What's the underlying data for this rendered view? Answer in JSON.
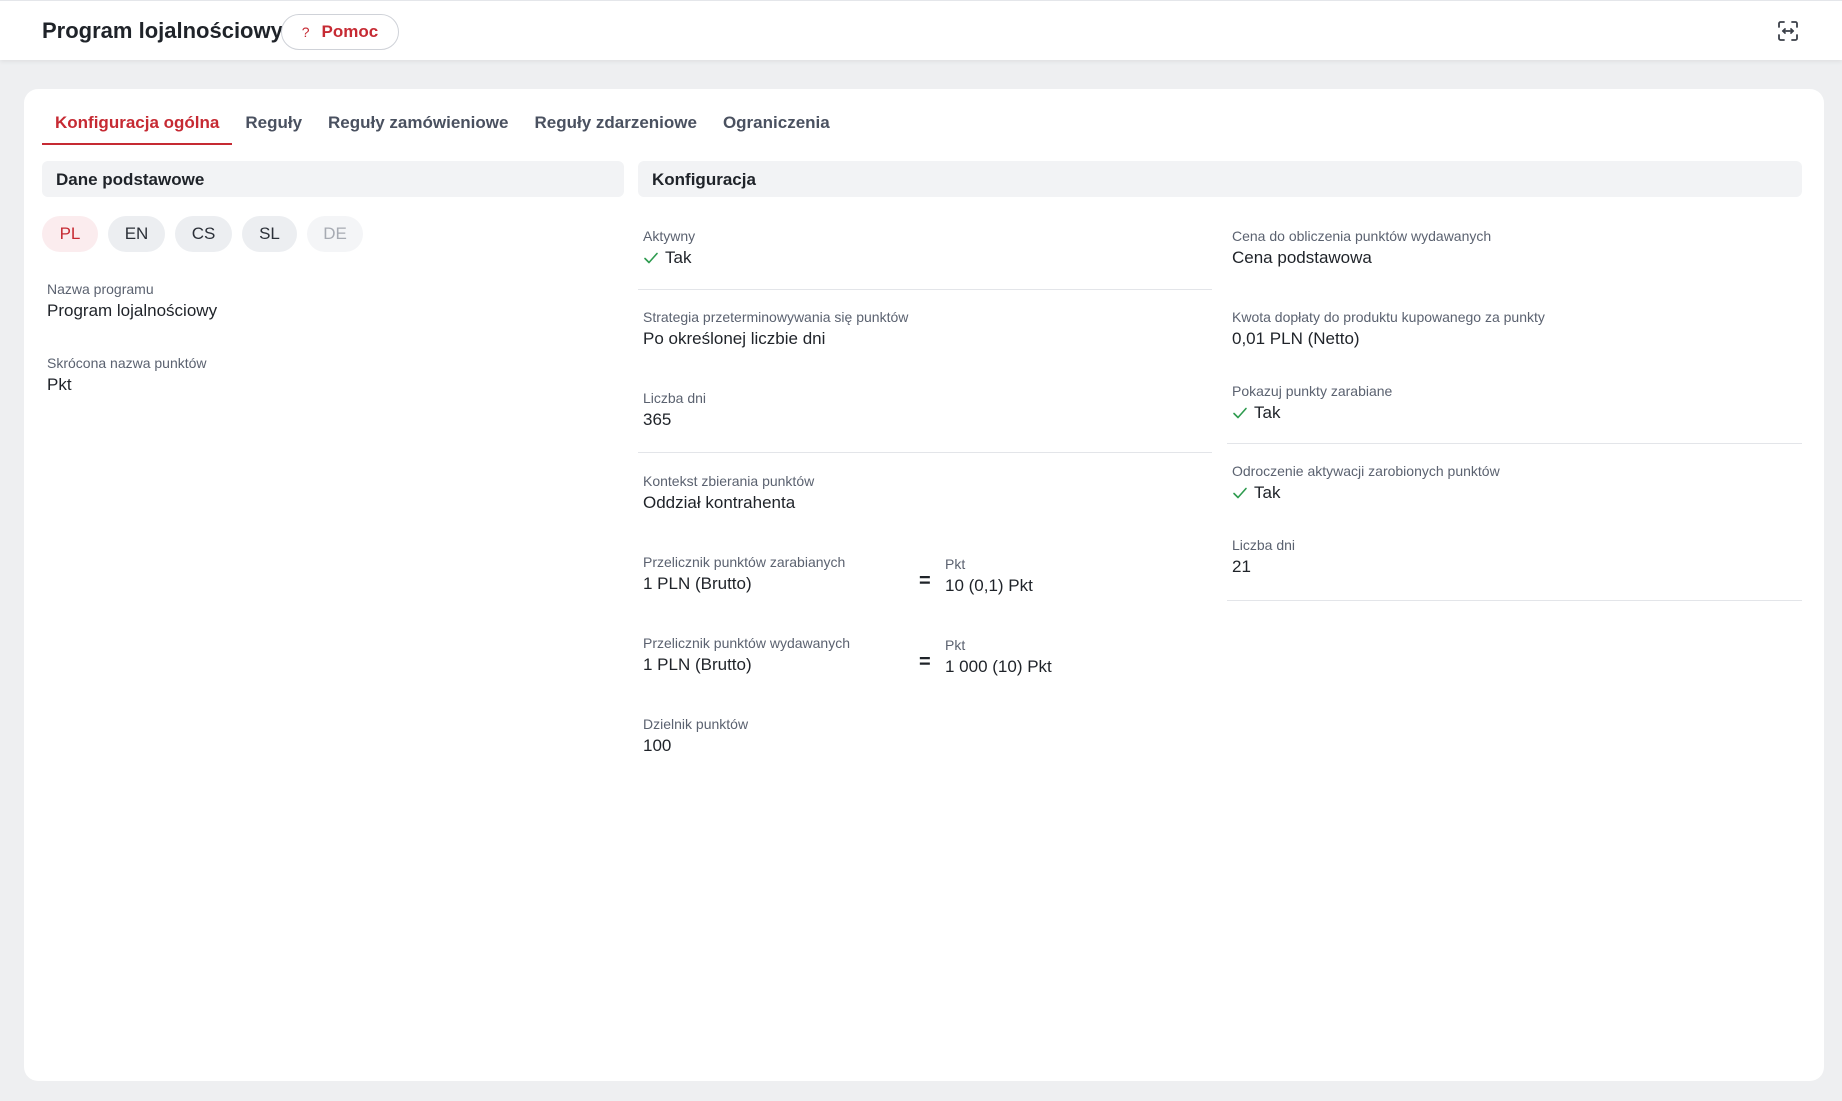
{
  "header": {
    "title": "Program lojalnościowy",
    "help_icon": "?",
    "help_label": "Pomoc"
  },
  "tabs": [
    {
      "label": "Konfiguracja ogólna",
      "active": true
    },
    {
      "label": "Reguły"
    },
    {
      "label": "Reguły zamówieniowe"
    },
    {
      "label": "Reguły zdarzeniowe"
    },
    {
      "label": "Ograniczenia"
    }
  ],
  "basic": {
    "header": "Dane podstawowe",
    "languages": [
      "PL",
      "EN",
      "CS",
      "SL",
      "DE"
    ],
    "active_language": "PL",
    "disabled_language": "DE",
    "program_name_label": "Nazwa programu",
    "program_name_value": "Program lojalnościowy",
    "short_name_label": "Skrócona nazwa punktów",
    "short_name_value": "Pkt"
  },
  "config": {
    "header": "Konfiguracja",
    "active_label": "Aktywny",
    "active_value": "Tak",
    "expiry_strategy_label": "Strategia przeterminowywania się punktów",
    "expiry_strategy_value": "Po określonej liczbie dni",
    "days_label": "Liczba dni",
    "days_value": "365",
    "context_label": "Kontekst zbierania punktów",
    "context_value": "Oddział kontrahenta",
    "earn_label": "Przelicznik punktów zarabianych",
    "earn_value": "1 PLN (Brutto)",
    "earn_eq": "=",
    "earn_unit_label": "Pkt",
    "earn_points": "10 (0,1) Pkt",
    "spend_label": "Przelicznik punktów wydawanych",
    "spend_value": "1 PLN (Brutto)",
    "spend_eq": "=",
    "spend_unit_label": "Pkt",
    "spend_points": "1 000 (10) Pkt",
    "divider_label": "Dzielnik punktów",
    "divider_value": "100",
    "price_label": "Cena do obliczenia punktów wydawanych",
    "price_value": "Cena podstawowa",
    "surcharge_label": "Kwota dopłaty do produktu kupowanego za punkty",
    "surcharge_value": "0,01 PLN (Netto)",
    "show_earned_label": "Pokazuj punkty zarabiane",
    "show_earned_value": "Tak",
    "delay_label": "Odroczenie aktywacji zarobionych punktów",
    "delay_value": "Tak",
    "delay_days_label": "Liczba dni",
    "delay_days_value": "21"
  },
  "colors": {
    "accent": "#c62a33",
    "check": "#2e9b4f"
  },
  "icons": {
    "expand": "expand-icon",
    "check": "check-icon"
  }
}
